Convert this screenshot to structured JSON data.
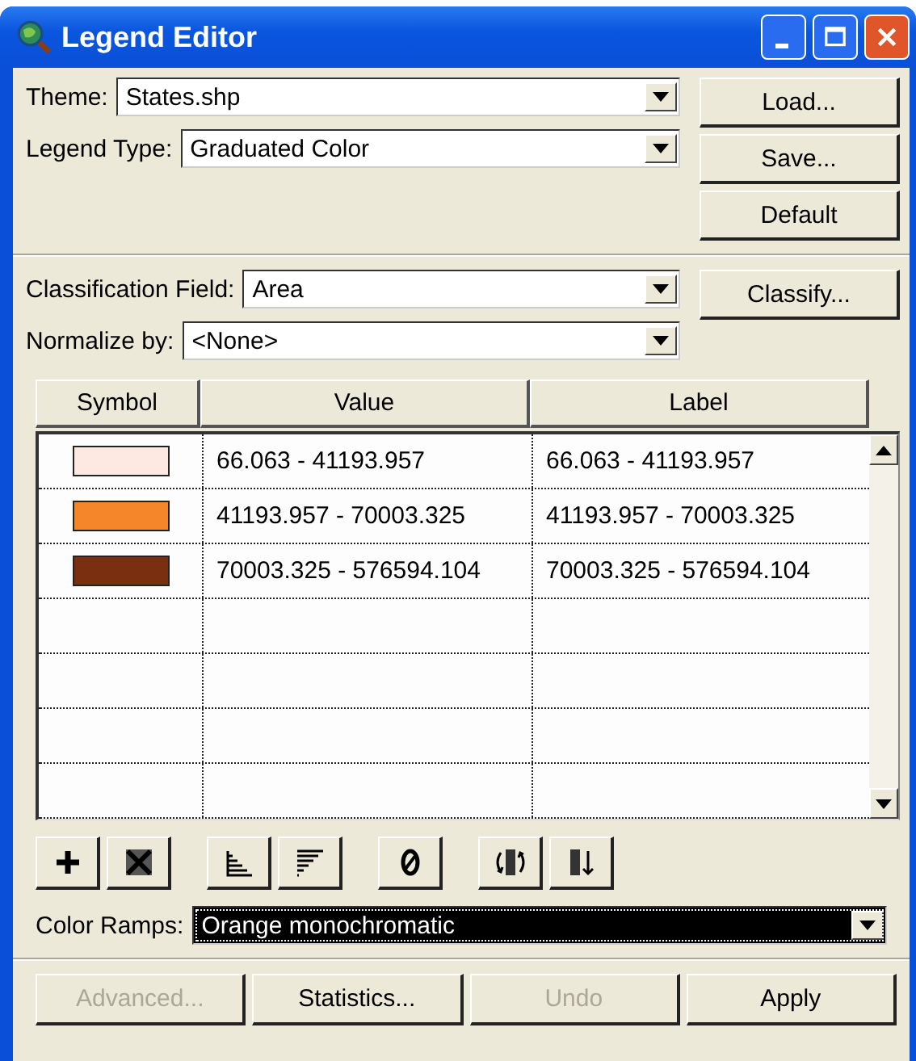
{
  "window": {
    "title": "Legend Editor"
  },
  "theme": {
    "label": "Theme:",
    "value": "States.shp"
  },
  "legend_type": {
    "label": "Legend Type:",
    "value": "Graduated Color"
  },
  "side_buttons": [
    {
      "label": "Load..."
    },
    {
      "label": "Save..."
    },
    {
      "label": "Default"
    }
  ],
  "classification_field": {
    "label": "Classification Field:",
    "value": "Area"
  },
  "classify_button": {
    "label": "Classify..."
  },
  "normalize_by": {
    "label": "Normalize by:",
    "value": "<None>"
  },
  "table": {
    "columns": [
      "Symbol",
      "Value",
      "Label"
    ],
    "rows": [
      {
        "color": "#fde9e1",
        "value": "66.063 - 41193.957",
        "label": "66.063 - 41193.957"
      },
      {
        "color": "#f5872a",
        "value": "41193.957 - 70003.325",
        "label": "41193.957 - 70003.325"
      },
      {
        "color": "#7a3010",
        "value": "70003.325 - 576594.104",
        "label": "70003.325 - 576594.104"
      }
    ]
  },
  "toolbar": [
    {
      "kind": "add"
    },
    {
      "kind": "delete"
    },
    {
      "kind": "ascending"
    },
    {
      "kind": "descending"
    },
    {
      "kind": "zero"
    },
    {
      "kind": "flip"
    },
    {
      "kind": "reverse"
    }
  ],
  "color_ramps": {
    "label": "Color Ramps:",
    "value": "Orange monochromatic",
    "highlighted": true
  },
  "bottom_buttons": [
    {
      "label": "Advanced...",
      "disabled": true
    },
    {
      "label": "Statistics...",
      "disabled": false
    },
    {
      "label": "Undo",
      "disabled": true
    },
    {
      "label": "Apply",
      "disabled": false
    }
  ]
}
